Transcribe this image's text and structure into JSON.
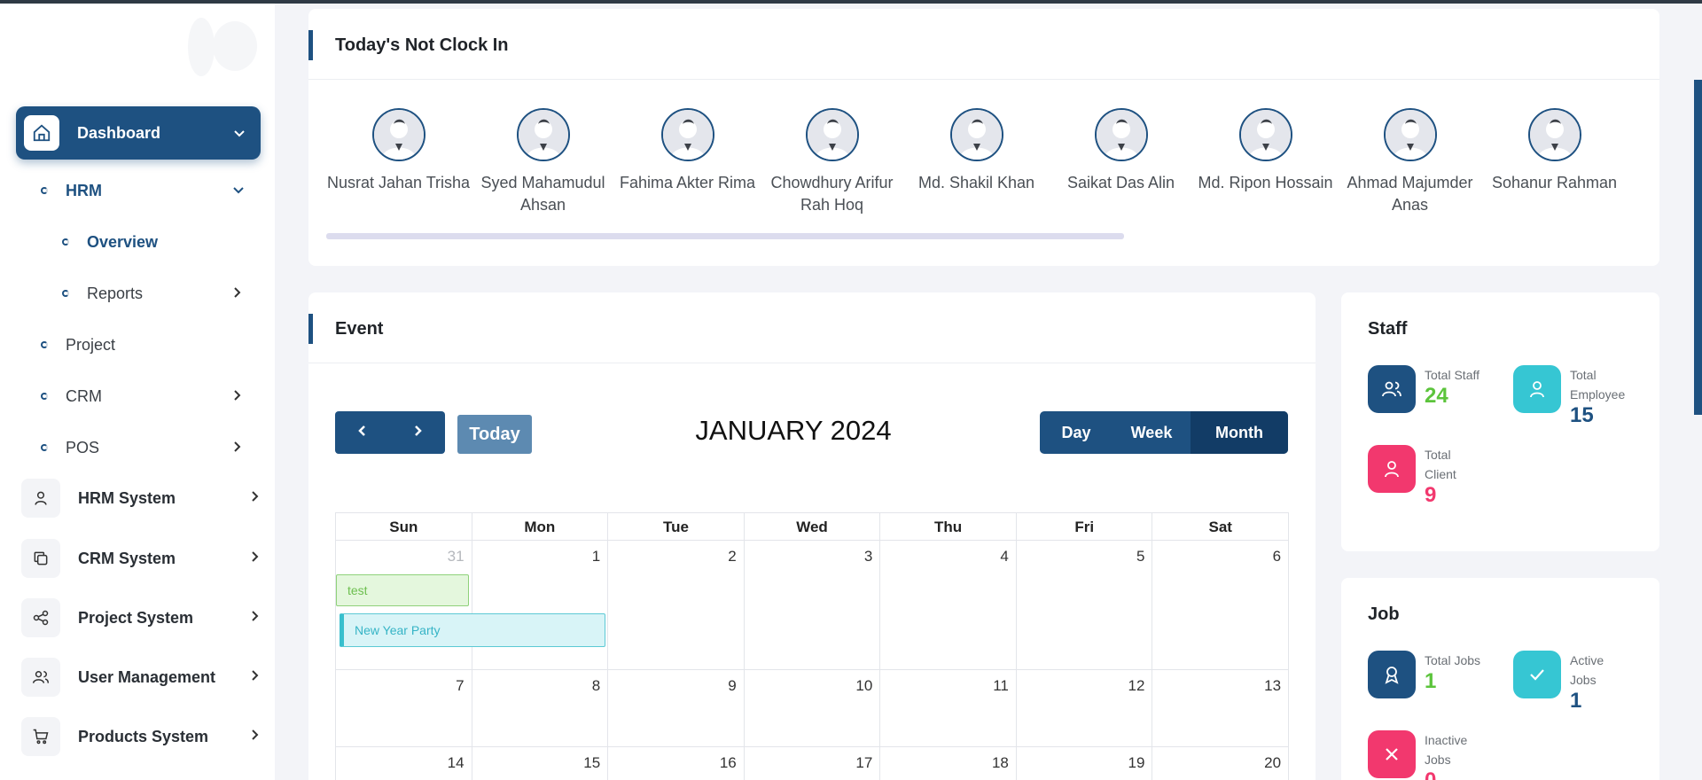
{
  "sidebar": {
    "dashboard": "Dashboard",
    "hrm": "HRM",
    "overview": "Overview",
    "reports": "Reports",
    "project": "Project",
    "crm": "CRM",
    "pos": "POS",
    "systems": [
      {
        "label": "HRM System",
        "icon": "user-icon"
      },
      {
        "label": "CRM System",
        "icon": "copy-icon"
      },
      {
        "label": "Project System",
        "icon": "share-icon"
      },
      {
        "label": "User Management",
        "icon": "users-icon"
      },
      {
        "label": "Products System",
        "icon": "cart-icon"
      }
    ]
  },
  "clockin": {
    "title": "Today's Not Clock In",
    "people": [
      {
        "name": "Nusrat Jahan Trisha"
      },
      {
        "name": "Syed Mahamudul Ahsan"
      },
      {
        "name": "Fahima Akter Rima"
      },
      {
        "name": "Chowdhury Arifur Rah Hoq"
      },
      {
        "name": "Md. Shakil Khan"
      },
      {
        "name": "Saikat Das Alin"
      },
      {
        "name": "Md. Ripon Hossain"
      },
      {
        "name": "Ahmad Majumder Anas"
      },
      {
        "name": "Sohanur Rahman"
      }
    ]
  },
  "event": {
    "title": "Event",
    "today": "Today",
    "month_title": "JANUARY 2024",
    "views": [
      "Day",
      "Week",
      "Month"
    ],
    "active_view": "Month",
    "dow": [
      "Sun",
      "Mon",
      "Tue",
      "Wed",
      "Thu",
      "Fri",
      "Sat"
    ],
    "weeks": [
      [
        "31",
        "1",
        "2",
        "3",
        "4",
        "5",
        "6"
      ],
      [
        "7",
        "8",
        "9",
        "10",
        "11",
        "12",
        "13"
      ],
      [
        "14",
        "15",
        "16",
        "17",
        "18",
        "19",
        "20"
      ]
    ],
    "events": [
      {
        "label": "test"
      },
      {
        "label": "New Year Party"
      }
    ]
  },
  "staff": {
    "title": "Staff",
    "total_staff_label": "Total Staff",
    "total_staff": "24",
    "total_employee_label": "Total Employee",
    "total_employee": "15",
    "total_client_label": "Total Client",
    "total_client": "9"
  },
  "job": {
    "title": "Job",
    "total_jobs_label": "Total Jobs",
    "total_jobs": "1",
    "active_jobs_label": "Active Jobs",
    "active_jobs": "1",
    "inactive_jobs_label": "Inactive Jobs",
    "inactive_jobs": "0"
  },
  "colors": {
    "primary": "#1e5181",
    "green": "#5cc43c",
    "cyan": "#36c6d3",
    "pink": "#f2386e"
  }
}
